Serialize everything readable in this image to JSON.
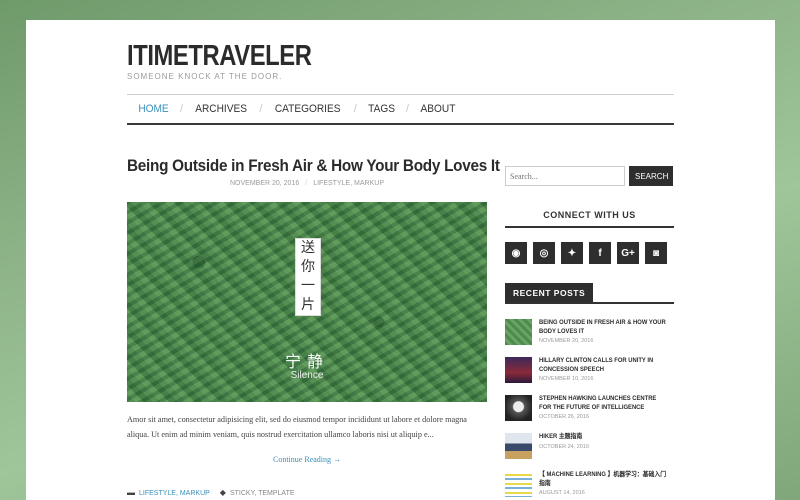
{
  "site": {
    "title": "ITIMETRAVELER",
    "tagline": "SOMEONE KNOCK AT THE DOOR."
  },
  "nav": {
    "items": [
      {
        "label": "HOME",
        "active": true
      },
      {
        "label": "ARCHIVES"
      },
      {
        "label": "CATEGORIES"
      },
      {
        "label": "TAGS"
      },
      {
        "label": "ABOUT"
      }
    ],
    "separator": "/"
  },
  "post": {
    "title": "Being Outside in Fresh Air & How Your Body Loves It",
    "date": "NOVEMBER 20, 2016",
    "categories": "LIFESTYLE, MARKUP",
    "image": {
      "vertical_text": [
        "送",
        "你",
        "一",
        "片"
      ],
      "zh_caption": "宁静",
      "en_caption": "Silence"
    },
    "excerpt": "Amor sit amet, consectetur adipisicing elit, sed do eiusmod tempor incididunt ut labore et dolore magna aliqua. Ut enim ad minim veniam, quis nostrud exercitation ullamco laboris nisi ut aliquip e...",
    "continue_label": "Continue Reading →",
    "footer_categories": "LIFESTYLE, MARKUP",
    "footer_tags": "STICKY, TEMPLATE"
  },
  "sidebar": {
    "search": {
      "placeholder": "Search...",
      "button_label": "SEARCH"
    },
    "connect_title": "CONNECT WITH US",
    "social": [
      {
        "icon": "github-icon",
        "glyph": "◉"
      },
      {
        "icon": "weibo-icon",
        "glyph": "◎"
      },
      {
        "icon": "twitter-icon",
        "glyph": "✦"
      },
      {
        "icon": "facebook-icon",
        "glyph": "f"
      },
      {
        "icon": "google-plus-icon",
        "glyph": "G+"
      },
      {
        "icon": "instagram-icon",
        "glyph": "◙"
      }
    ],
    "recent_title": "RECENT POSTS",
    "recent_posts": [
      {
        "title": "BEING OUTSIDE IN FRESH AIR & HOW YOUR BODY LOVES IT",
        "date": "NOVEMBER 20, 2016"
      },
      {
        "title": "HILLARY CLINTON CALLS FOR UNITY IN CONCESSION SPEECH",
        "date": "NOVEMBER 10, 2016"
      },
      {
        "title": "STEPHEN HAWKING LAUNCHES CENTRE FOR THE FUTURE OF INTELLIGENCE",
        "date": "OCTOBER 26, 2016"
      },
      {
        "title": "HIKER 主题指南",
        "date": "OCTOBER 24, 2016"
      },
      {
        "title": "【 MACHINE LEARNING 】机器学习：基础入门指南",
        "date": "AUGUST 14, 2016"
      }
    ]
  },
  "colors": {
    "accent": "#3a8fb7",
    "dark": "#2e2e2e"
  }
}
